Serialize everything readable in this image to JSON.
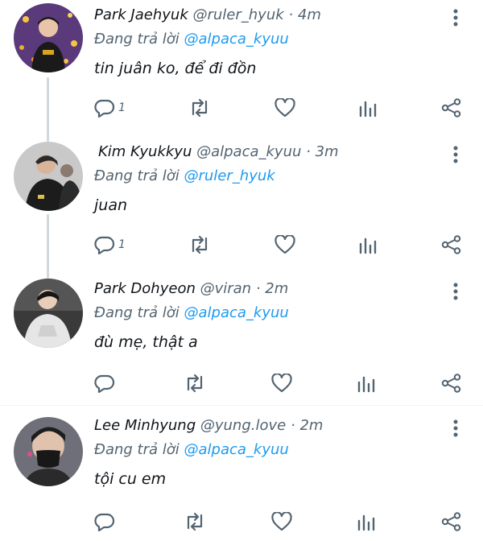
{
  "colors": {
    "link": "#1d9bf0",
    "muted": "#536471",
    "text": "#0f1419",
    "thread_line": "#cfd9de"
  },
  "tweets": [
    {
      "name": "Park Jaehyuk",
      "handle": "@ruler_hyuk",
      "time": "4m",
      "replying_prefix": "Đang trả lời",
      "replying_to": "@alpaca_kyuu",
      "text": "tin juân ko, để đi đồn",
      "reply_count": "1",
      "icons": [
        "reply-icon",
        "retweet-icon",
        "like-icon",
        "views-icon",
        "share-icon",
        "more-icon"
      ]
    },
    {
      "name": "Kim Kyukkyu",
      "handle": "@alpaca_kyuu",
      "time": "3m",
      "replying_prefix": "Đang trả lời",
      "replying_to": "@ruler_hyuk",
      "text": "juan",
      "reply_count": "1",
      "icons": [
        "reply-icon",
        "retweet-icon",
        "like-icon",
        "views-icon",
        "share-icon",
        "more-icon"
      ]
    },
    {
      "name": "Park Dohyeon",
      "handle": "@viran",
      "time": "2m",
      "replying_prefix": "Đang trả lời",
      "replying_to": "@alpaca_kyuu",
      "text": "đù mẹ, thật a",
      "reply_count": "",
      "icons": [
        "reply-icon",
        "retweet-icon",
        "like-icon",
        "views-icon",
        "share-icon",
        "more-icon"
      ]
    },
    {
      "name": "Lee Minhyung",
      "handle": "@yung.love",
      "time": "2m",
      "replying_prefix": "Đang trả lời",
      "replying_to": "@alpaca_kyuu",
      "text": "tội cu em",
      "reply_count": "",
      "icons": [
        "reply-icon",
        "retweet-icon",
        "like-icon",
        "views-icon",
        "share-icon",
        "more-icon"
      ]
    }
  ]
}
